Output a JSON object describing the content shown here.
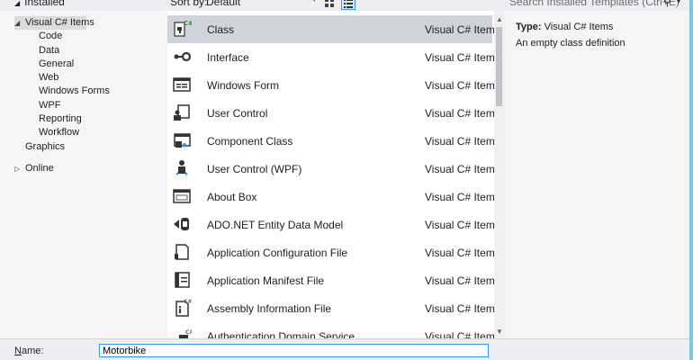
{
  "tree": {
    "installed": "Installed",
    "selected": "Visual C# Items",
    "children": [
      "Code",
      "Data",
      "General",
      "Web",
      "Windows Forms",
      "WPF",
      "Reporting",
      "Workflow"
    ],
    "graphics": "Graphics",
    "online": "Online"
  },
  "toolbar": {
    "sort_label": "Sort by:",
    "sort_value": "Default",
    "search_placeholder": "Search Installed Templates (Ctrl+E)"
  },
  "templates": [
    {
      "name": "Class",
      "category": "Visual C# Items",
      "icon": "class-icon"
    },
    {
      "name": "Interface",
      "category": "Visual C# Items",
      "icon": "interface-icon"
    },
    {
      "name": "Windows Form",
      "category": "Visual C# Items",
      "icon": "windows-form-icon"
    },
    {
      "name": "User Control",
      "category": "Visual C# Items",
      "icon": "user-control-icon"
    },
    {
      "name": "Component Class",
      "category": "Visual C# Items",
      "icon": "component-class-icon"
    },
    {
      "name": "User Control (WPF)",
      "category": "Visual C# Items",
      "icon": "user-control-wpf-icon"
    },
    {
      "name": "About Box",
      "category": "Visual C# Items",
      "icon": "about-box-icon"
    },
    {
      "name": "ADO.NET Entity Data Model",
      "category": "Visual C# Items",
      "icon": "entity-data-model-icon"
    },
    {
      "name": "Application Configuration File",
      "category": "Visual C# Items",
      "icon": "config-file-icon"
    },
    {
      "name": "Application Manifest File",
      "category": "Visual C# Items",
      "icon": "manifest-file-icon"
    },
    {
      "name": "Assembly Information File",
      "category": "Visual C# Items",
      "icon": "assembly-info-icon"
    },
    {
      "name": "Authentication Domain Service",
      "category": "Visual C# Items",
      "icon": "domain-service-icon"
    }
  ],
  "details": {
    "type_label": "Type:",
    "type_value": "Visual C# Items",
    "description": "An empty class definition"
  },
  "name_field": {
    "label_prefix": "N",
    "label_rest": "ame:",
    "value": "Motorbike"
  },
  "colors": {
    "accent": "#3399ff",
    "selected_row": "#cfd3db",
    "panel": "#f5f5f5"
  }
}
